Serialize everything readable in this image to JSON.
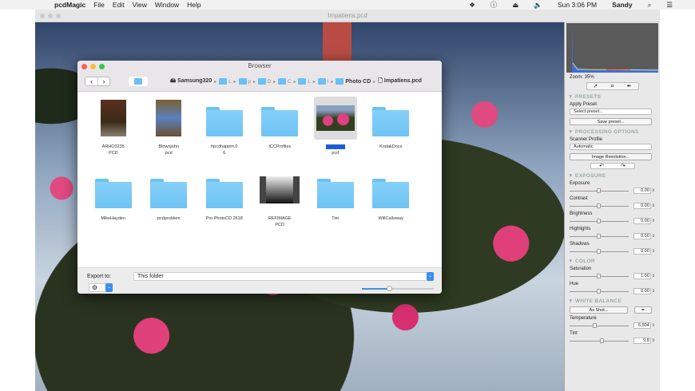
{
  "menubar": {
    "app": "pcdMagic",
    "items": [
      "File",
      "Edit",
      "View",
      "Window",
      "Help"
    ],
    "clock": "Sun 3:06 PM",
    "user": "Sandy"
  },
  "window": {
    "title": "Impatiens.pcd"
  },
  "panel": {
    "zoom": "Zoom: 35%",
    "presets": {
      "header": "PRESETS",
      "apply_label": "Apply Preset",
      "select": "Select preset...",
      "save": "Save preset..."
    },
    "processing": {
      "header": "PROCESSING OPTIONS",
      "profile_label": "Scanner Profile",
      "profile": "Automatic",
      "resolution": "Image Resolution..."
    },
    "exposure": {
      "header": "EXPOSURE",
      "sliders": [
        {
          "label": "Exposure",
          "value": "0.00",
          "pos": 0.5
        },
        {
          "label": "Contrast",
          "value": "0.00",
          "pos": 0.5
        },
        {
          "label": "Brightness",
          "value": "0.00",
          "pos": 0.5
        },
        {
          "label": "Highlights",
          "value": "0.00",
          "pos": 0.5
        },
        {
          "label": "Shadows",
          "value": "0.00",
          "pos": 0.5
        }
      ]
    },
    "color": {
      "header": "COLOR",
      "sliders": [
        {
          "label": "Saturation",
          "value": "1.00",
          "pos": 0.5
        },
        {
          "label": "Hue",
          "value": "0.00",
          "pos": 0.5
        }
      ]
    },
    "white_balance": {
      "header": "WHITE BALANCE",
      "as_shot": "As Shot...",
      "sliders": [
        {
          "label": "Temperature",
          "value": "6,504",
          "pos": 0.43
        },
        {
          "label": "Tint",
          "value": "9.8",
          "pos": 0.55
        }
      ]
    }
  },
  "browser": {
    "title": "Browser",
    "breadcrumb": [
      "Samsung320",
      "L",
      "p",
      "D",
      "C",
      "L",
      "I",
      "Photo CD",
      "Impatiens.pcd"
    ],
    "items": [
      {
        "name": "ARHO3235\nPCD",
        "type": "photo1"
      },
      {
        "name": "Blownjohn\npcd",
        "type": "photo2"
      },
      {
        "name": "hpcdhappm.0\n6",
        "type": "folder"
      },
      {
        "name": "ICCProfiles",
        "type": "folder"
      },
      {
        "name": "Impatiens\npcd",
        "type": "photo3",
        "selected": true
      },
      {
        "name": "KodakDocs",
        "type": "folder"
      },
      {
        "name": "MikeHayden",
        "type": "folder"
      },
      {
        "name": "pcdproblem",
        "type": "folder"
      },
      {
        "name": "Pro PhotoCD 2618",
        "type": "folder"
      },
      {
        "name": "REFIMAGE\nPCD",
        "type": "gray"
      },
      {
        "name": "Tim",
        "type": "folder"
      },
      {
        "name": "WillCalloway",
        "type": "folder"
      }
    ],
    "export_label": "Export to:",
    "export_value": "This folder",
    "thumb_size": 0.38
  }
}
